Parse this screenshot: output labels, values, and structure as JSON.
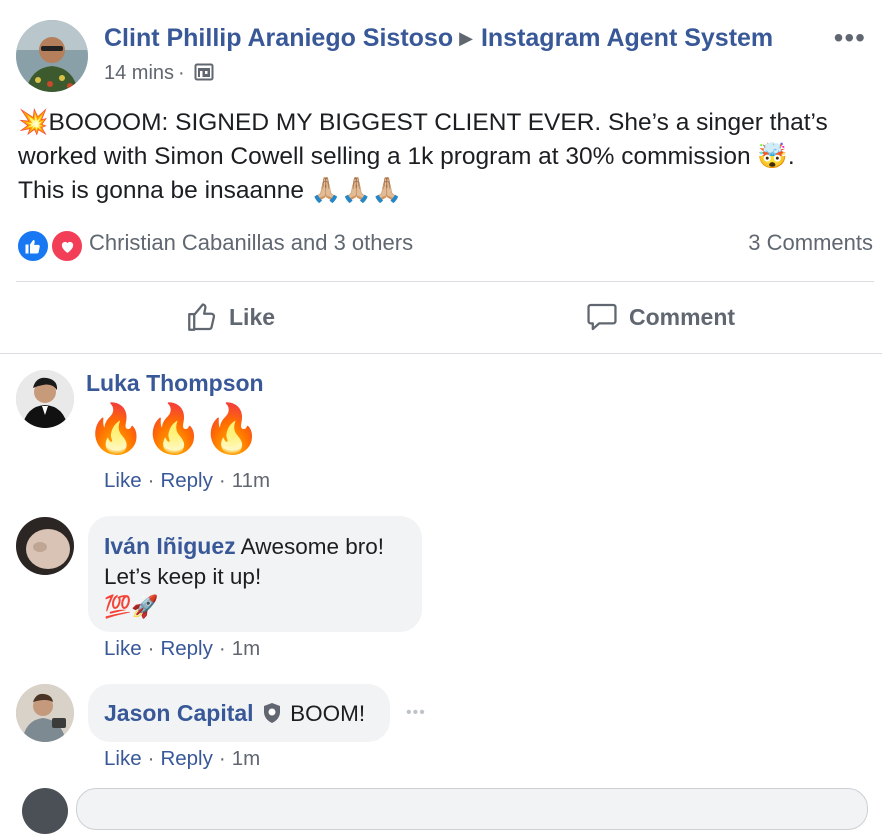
{
  "post": {
    "author": "Clint Phillip Araniego Sistoso",
    "group": "Instagram Agent System",
    "time": "14 mins",
    "meta_separator": "·",
    "more_label": "•••",
    "text_line1": "💥BOOOOM: SIGNED MY BIGGEST CLIENT EVER. She’s a singer that’s",
    "text_line2": "worked with Simon Cowell selling a 1k program at 30% commission 🤯.",
    "text_line3": "This is gonna be insaanne 🙏🏼🙏🏼🙏🏼",
    "reactions_text": "Christian Cabanillas and 3 others",
    "comments_count": "3 Comments"
  },
  "actions": {
    "like": "Like",
    "comment": "Comment"
  },
  "comments": [
    {
      "name": "Luka Thompson",
      "text": "🔥🔥🔥",
      "like": "Like",
      "reply": "Reply",
      "sep": "·",
      "time": "11m"
    },
    {
      "name": "Iván Iñiguez",
      "text_line1": "Awesome bro!",
      "text_line2": "Let’s keep it up!",
      "text_line3": "💯🚀",
      "like": "Like",
      "reply": "Reply",
      "sep": "·",
      "time": "1m"
    },
    {
      "name": "Jason Capital",
      "text": "BOOM!",
      "like": "Like",
      "reply": "Reply",
      "sep": "·",
      "time": "1m",
      "more_label": "•••"
    }
  ],
  "colors": {
    "link_blue": "#385898",
    "like_blue": "#1877f2",
    "love_red": "#f33e58",
    "muted_gray": "#606770",
    "bubble_gray": "#f2f3f5"
  },
  "icons": [
    "thumbs-up-icon",
    "heart-icon",
    "globe-group-icon",
    "comment-icon",
    "verified-badge-icon",
    "more-dots-icon"
  ]
}
